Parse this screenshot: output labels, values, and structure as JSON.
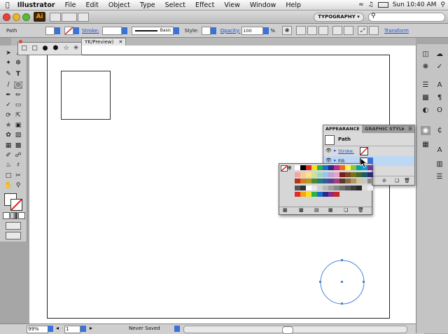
{
  "menubar": {
    "app_name": "Illustrator",
    "items": [
      "File",
      "Edit",
      "Object",
      "Type",
      "Select",
      "Effect",
      "View",
      "Window",
      "Help"
    ],
    "clock": "Sun 10:40 AM"
  },
  "appbar": {
    "logo": "Ai",
    "workspace": "TYPOGRAPHY"
  },
  "control_bar": {
    "selection_label": "Path",
    "stroke_label": "Stroke:",
    "brush_label": "Basic",
    "style_label": "Style:",
    "opacity_label": "Opacity:",
    "opacity_value": "100",
    "opacity_unit": "%",
    "transform_label": "Transform"
  },
  "document_tab": {
    "title": "YK/Preview)"
  },
  "status_bar": {
    "zoom": "99%",
    "artboard": "1",
    "status": "Never Saved"
  },
  "appearance_panel": {
    "tab_appearance": "APPEARANCE",
    "tab_graphic_styles": "GRAPHIC STYLI",
    "object_label": "Path",
    "stroke_label": "Stroke:",
    "fill_label": "Fill:"
  },
  "colors": {
    "ai_brand": "#f7a21b",
    "ai_bg": "#3b2208",
    "link_blue": "#1a4fd0",
    "highlight_row": "#bcd8f5",
    "selection_blue": "#4a84d4"
  },
  "swatches": [
    [
      "#ffffff",
      "#000000",
      "#e52929",
      "#f7e017",
      "#2bb24c",
      "#1c6fc9",
      "#2b2b8c",
      "#c42a8a",
      "#ed6b1e",
      "#fff44f",
      "#8cc63e",
      "#00a3a6",
      "#1a9bd7",
      "#6a3a9b"
    ],
    [
      "#f4a4a4",
      "#f6c99b",
      "#ffe08a",
      "#c9e39a",
      "#9fd6c1",
      "#9bc3e8",
      "#b6a5d6",
      "#e4a3c8",
      "#7a1f1f",
      "#7a4a1f",
      "#7a6f1f",
      "#3b6e23",
      "#1f5a6e",
      "#2b2b6e"
    ],
    [
      "#b5351b",
      "#d97a20",
      "#b39b23",
      "#4c8b2b",
      "#247b7b",
      "#2e5c9e",
      "#5b3e8f",
      "#a13e7f",
      "#5b3a22",
      "#8a6a45",
      "#b4956a",
      "#d6c29c",
      "#c5c5c5",
      "#888888"
    ],
    [
      "#555555",
      "#333333",
      "#ffffff",
      "#e8e8e8",
      "#d0d0d0",
      "#b8b8b8",
      "#a0a0a0",
      "#888888",
      "#707070",
      "#585858",
      "#404040",
      "#282828",
      "#dddddd",
      "#eeeeee"
    ],
    [
      "#e52929",
      "#f7a21b",
      "#f7e017",
      "#2bb24c",
      "#1c6fc9",
      "#2b2b8c",
      "#8c2b8c",
      "#c42a2a"
    ]
  ]
}
